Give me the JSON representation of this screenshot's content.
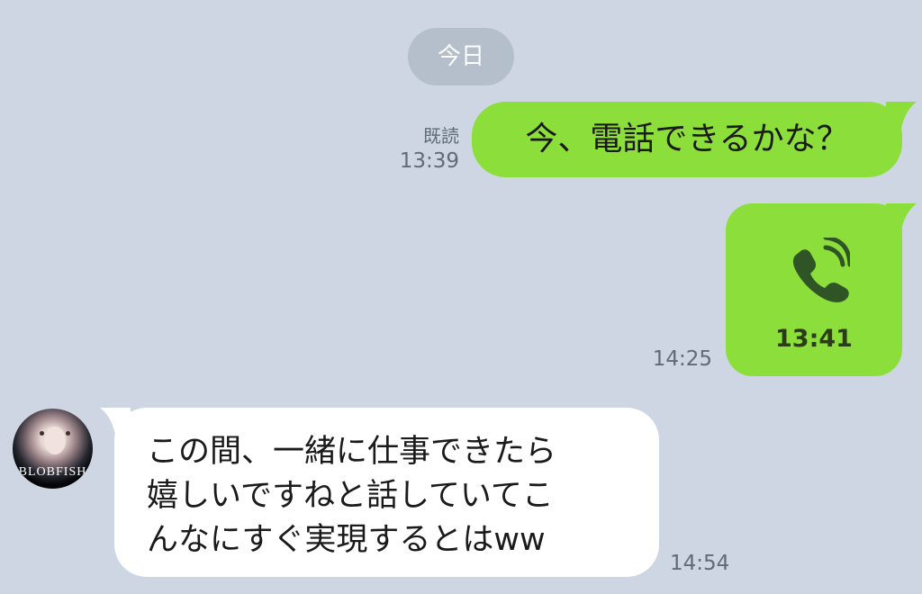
{
  "chat": {
    "date_label": "今日",
    "messages": [
      {
        "id": "msg1",
        "side": "right",
        "text": "今、電話できるかな？",
        "read_label": "既読",
        "time": "13:39"
      },
      {
        "id": "msg2",
        "side": "right",
        "type": "call",
        "icon": "phone-ringing-icon",
        "duration": "13:41",
        "time": "14:25"
      },
      {
        "id": "msg3",
        "side": "left",
        "avatar_text": "BLOBFISH",
        "text": "この間、一緒に仕事できたら\n嬉しいですねと話していてこ\nんなにすぐ実現するとはww",
        "time": "14:54"
      }
    ]
  },
  "colors": {
    "background": "#cdd6e2",
    "outgoing_bubble": "#8cde3a",
    "incoming_bubble": "#ffffff",
    "date_chip": "#b5bfcc",
    "meta_text": "#5f6b79"
  }
}
